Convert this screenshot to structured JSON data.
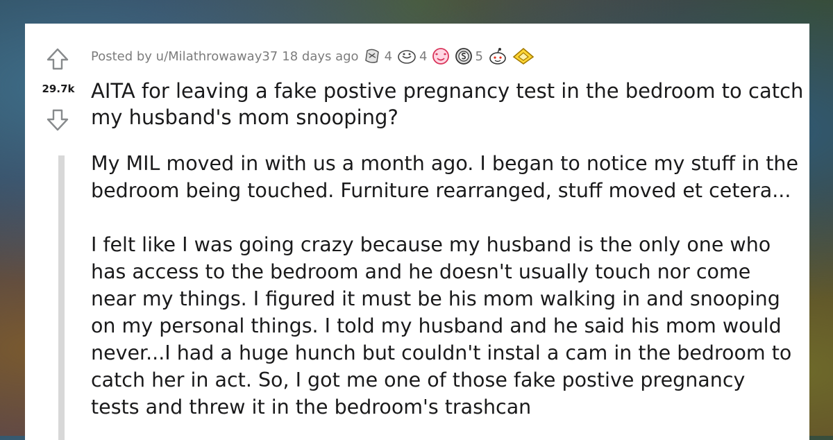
{
  "post": {
    "score": "29.7k",
    "posted_by": "Posted by u/Milathrowaway37",
    "age": "18 days ago",
    "awards": [
      {
        "icon": "silver-award-icon",
        "count": "4"
      },
      {
        "icon": "helpful-award-icon",
        "count": "4"
      },
      {
        "icon": "wholesome-award-icon",
        "count": ""
      },
      {
        "icon": "coin-award-icon",
        "count": "5"
      },
      {
        "icon": "snoo-award-icon",
        "count": ""
      },
      {
        "icon": "gold-award-icon",
        "count": ""
      }
    ],
    "title": "AITA for leaving a fake postive pregnancy test in the bedroom to catch my husband's mom snooping?",
    "paragraphs": [
      "My MIL moved in with us a month ago. I began to notice my stuff in the bedroom being touched. Furniture rearranged, stuff moved et cetera...",
      "I felt like I was going crazy because my husband is the only one who has access to the bedroom and he doesn't usually touch nor come near my things. I figured it must be his mom walking in and snooping on my personal things. I told my husband and he said his mom would never...I had a huge hunch but couldn't instal a cam in the bedroom to catch her in act. So, I got me one of those fake postive pregnancy tests and threw it in the bedroom's trashcan"
    ]
  },
  "colors": {
    "text": "#1a1a1b",
    "meta": "#7c7c7c",
    "arrow": "#878a8c",
    "quote_bar": "#d8d8d8"
  }
}
